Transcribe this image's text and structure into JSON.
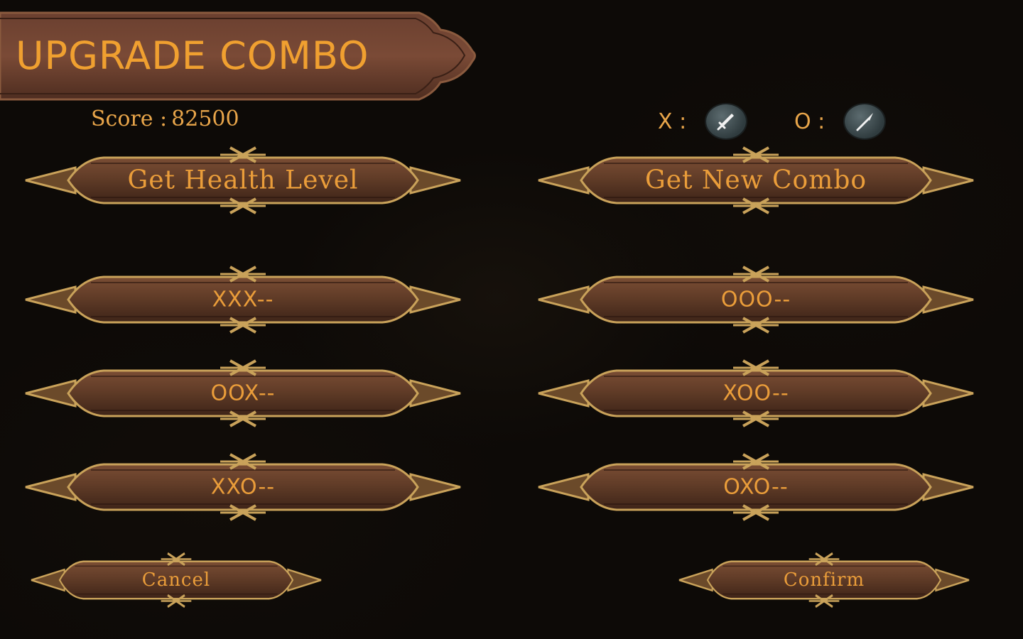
{
  "header": {
    "title": "UPGRADE COMBO"
  },
  "score": {
    "label": "Score :",
    "value": "82500"
  },
  "legend": {
    "x": {
      "key": "X :",
      "icon": "sword-icon"
    },
    "o": {
      "key": "O :",
      "icon": "spear-icon"
    }
  },
  "actions": {
    "health": "Get Health Level",
    "new_combo": "Get New Combo",
    "cancel": "Cancel",
    "confirm": "Confirm"
  },
  "combos": {
    "left": [
      "XXX--",
      "OOX--",
      "XXO--"
    ],
    "right": [
      "OOO--",
      "XOO--",
      "OXO--"
    ]
  },
  "colors": {
    "accent_text": "#ea9d3a",
    "button_wood": "#5e3a26",
    "frame_gold": "#c9a25a",
    "background": "#0d0a07"
  }
}
